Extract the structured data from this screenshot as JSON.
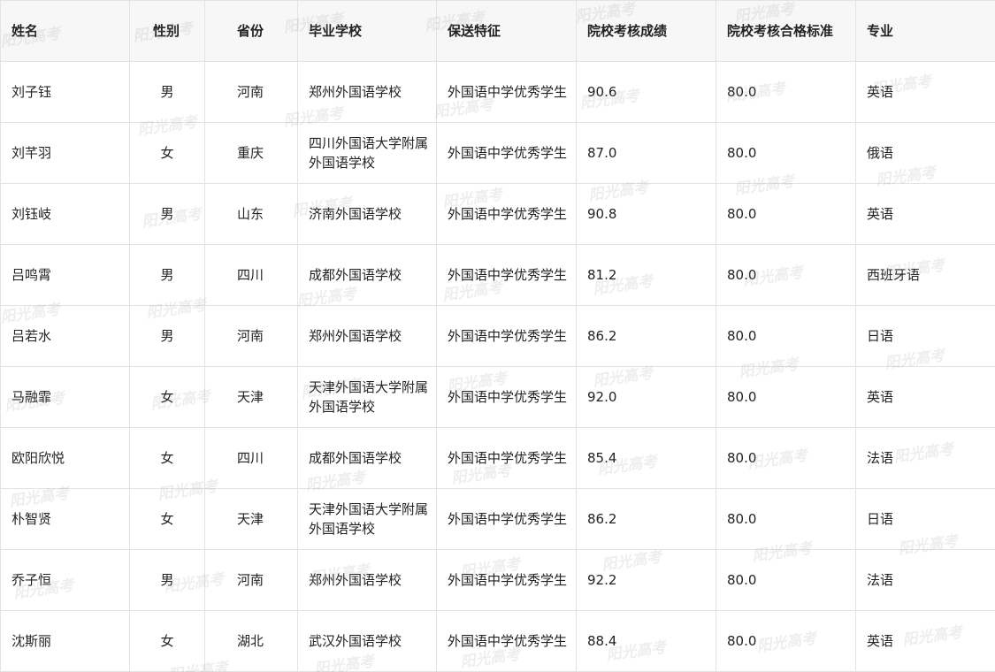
{
  "table": {
    "headers": [
      "姓名",
      "性别",
      "省份",
      "毕业学校",
      "保送特征",
      "院校考核成绩",
      "院校考核合格标准",
      "专业"
    ],
    "rows": [
      [
        "刘子钰",
        "男",
        "河南",
        "郑州外国语学校",
        "外国语中学优秀学生",
        "90.6",
        "80.0",
        "英语"
      ],
      [
        "刘芊羽",
        "女",
        "重庆",
        "四川外国语大学附属外国语学校",
        "外国语中学优秀学生",
        "87.0",
        "80.0",
        "俄语"
      ],
      [
        "刘钰岐",
        "男",
        "山东",
        "济南外国语学校",
        "外国语中学优秀学生",
        "90.8",
        "80.0",
        "英语"
      ],
      [
        "吕鸣霄",
        "男",
        "四川",
        "成都外国语学校",
        "外国语中学优秀学生",
        "81.2",
        "80.0",
        "西班牙语"
      ],
      [
        "吕若水",
        "男",
        "河南",
        "郑州外国语学校",
        "外国语中学优秀学生",
        "86.2",
        "80.0",
        "日语"
      ],
      [
        "马融霏",
        "女",
        "天津",
        "天津外国语大学附属外国语学校",
        "外国语中学优秀学生",
        "92.0",
        "80.0",
        "英语"
      ],
      [
        "欧阳欣悦",
        "女",
        "四川",
        "成都外国语学校",
        "外国语中学优秀学生",
        "85.4",
        "80.0",
        "法语"
      ],
      [
        "朴智贤",
        "女",
        "天津",
        "天津外国语大学附属外国语学校",
        "外国语中学优秀学生",
        "86.2",
        "80.0",
        "日语"
      ],
      [
        "乔子恒",
        "男",
        "河南",
        "郑州外国语学校",
        "外国语中学优秀学生",
        "92.2",
        "80.0",
        "法语"
      ],
      [
        "沈斯丽",
        "女",
        "湖北",
        "武汉外国语学校",
        "外国语中学优秀学生",
        "88.4",
        "80.0",
        "英语"
      ]
    ]
  },
  "watermark": {
    "text": "阳光高考",
    "color": "#969696"
  }
}
